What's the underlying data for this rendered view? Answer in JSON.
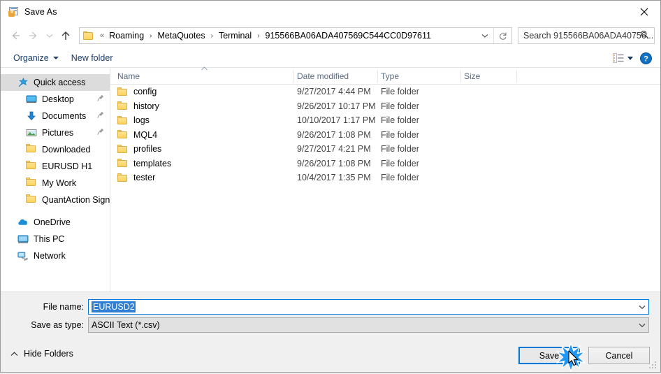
{
  "window": {
    "title": "Save As",
    "icon": "save-as-app-icon",
    "close_label": "×"
  },
  "nav": {
    "back_icon": "arrow-left-icon",
    "forward_icon": "arrow-right-icon",
    "recent_icon": "chevron-down-icon",
    "up_icon": "arrow-up-icon",
    "folder_icon": "folder-icon",
    "breadcrumbs": [
      "Roaming",
      "MetaQuotes",
      "Terminal",
      "915566BA06ADA407569C544CC0D97611"
    ],
    "leading_chevron": "«",
    "separator": "›",
    "dropdown_icon": "chevron-down-icon",
    "refresh_icon": "refresh-icon"
  },
  "search": {
    "placeholder": "Search 915566BA06ADA40756...",
    "icon": "search-icon"
  },
  "toolbar": {
    "organize_label": "Organize",
    "new_folder_label": "New folder",
    "view_icon": "list-view-icon",
    "view_caret_icon": "chevron-down-icon",
    "help_icon": "help-circle-icon",
    "help_label": "?"
  },
  "sidebar": {
    "items": [
      {
        "label": "Quick access",
        "icon": "star-pin-icon",
        "level": 0,
        "selected": true,
        "pinned": false
      },
      {
        "label": "Desktop",
        "icon": "desktop-icon",
        "level": 1,
        "selected": false,
        "pinned": true
      },
      {
        "label": "Documents",
        "icon": "documents-download-icon",
        "level": 1,
        "selected": false,
        "pinned": true
      },
      {
        "label": "Pictures",
        "icon": "pictures-icon",
        "level": 1,
        "selected": false,
        "pinned": true
      },
      {
        "label": "Downloaded",
        "icon": "folder-icon",
        "level": 1,
        "selected": false,
        "pinned": false
      },
      {
        "label": "EURUSD H1",
        "icon": "folder-icon",
        "level": 1,
        "selected": false,
        "pinned": false
      },
      {
        "label": "My Work",
        "icon": "folder-icon",
        "level": 1,
        "selected": false,
        "pinned": false
      },
      {
        "label": "QuantAction Signal",
        "icon": "folder-icon",
        "level": 1,
        "selected": false,
        "pinned": false
      },
      {
        "label": "OneDrive",
        "icon": "onedrive-cloud-icon",
        "level": 0,
        "selected": false,
        "pinned": false
      },
      {
        "label": "This PC",
        "icon": "this-pc-icon",
        "level": 0,
        "selected": false,
        "pinned": false
      },
      {
        "label": "Network",
        "icon": "network-icon",
        "level": 0,
        "selected": false,
        "pinned": false
      }
    ]
  },
  "filelist": {
    "columns": [
      "Name",
      "Date modified",
      "Type",
      "Size"
    ],
    "sort_column": "Name",
    "sort_direction": "ascending",
    "rows": [
      {
        "name": "config",
        "date": "9/27/2017 4:44 PM",
        "type": "File folder",
        "size": "",
        "icon": "folder-icon"
      },
      {
        "name": "history",
        "date": "9/26/2017 10:17 PM",
        "type": "File folder",
        "size": "",
        "icon": "folder-icon"
      },
      {
        "name": "logs",
        "date": "10/10/2017 1:17 PM",
        "type": "File folder",
        "size": "",
        "icon": "folder-icon"
      },
      {
        "name": "MQL4",
        "date": "9/26/2017 1:08 PM",
        "type": "File folder",
        "size": "",
        "icon": "folder-icon"
      },
      {
        "name": "profiles",
        "date": "9/27/2017 4:21 PM",
        "type": "File folder",
        "size": "",
        "icon": "folder-icon"
      },
      {
        "name": "templates",
        "date": "9/26/2017 1:08 PM",
        "type": "File folder",
        "size": "",
        "icon": "folder-icon"
      },
      {
        "name": "tester",
        "date": "10/4/2017 1:35 PM",
        "type": "File folder",
        "size": "",
        "icon": "folder-icon"
      }
    ]
  },
  "form": {
    "filename_label": "File name:",
    "filename_value": "EURUSD2",
    "filetype_label": "Save as type:",
    "filetype_value": "ASCII Text (*.csv)",
    "dropdown_icon": "chevron-down-icon"
  },
  "footer": {
    "hide_folders_label": "Hide Folders",
    "hide_folders_icon": "chevron-up-icon",
    "save_label": "Save",
    "cancel_label": "Cancel",
    "resize_grip_icon": "resize-grip-icon",
    "click_marker_icon": "click-burst-icon",
    "cursor_icon": "mouse-pointer-icon"
  },
  "colors": {
    "accent": "#0078d7",
    "selection": "#2f7fd4",
    "toolbar_text": "#1a3c6e",
    "column_header_text": "#5a6a80",
    "folder_yellow": "#fcd25c",
    "sidebar_selected": "#dcdcdc"
  }
}
